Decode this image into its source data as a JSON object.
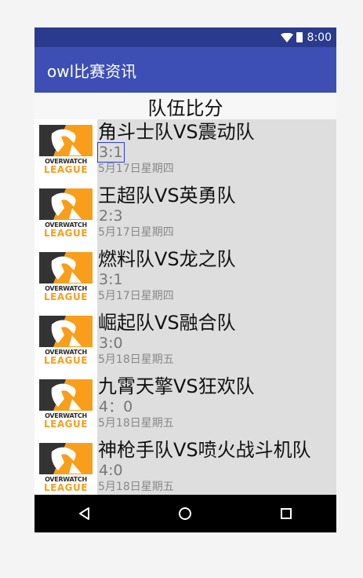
{
  "status_bar": {
    "time": "8:00",
    "wifi_icon": "wifi-icon",
    "battery_icon": "battery-icon"
  },
  "app_bar": {
    "title": "owl比赛资讯"
  },
  "section": {
    "title": "队伍比分"
  },
  "logo": {
    "top_text": "OVERWATCH",
    "bottom_text": "LEAGUE",
    "accent_color": "#f99e1a"
  },
  "matches": [
    {
      "teams": "角斗士队VS震动队",
      "score": "3:1",
      "date": "5月17日星期四"
    },
    {
      "teams": "王超队VS英勇队",
      "score": "2:3",
      "date": "5月17日星期四"
    },
    {
      "teams": "燃料队VS龙之队",
      "score": "3:1",
      "date": "5月17日星期四"
    },
    {
      "teams": "崛起队VS融合队",
      "score": "3:0",
      "date": "5月18日星期五"
    },
    {
      "teams": "九霄天擎VS狂欢队",
      "score": "4：0",
      "date": "5月18日星期五"
    },
    {
      "teams": "神枪手队VS喷火战斗机队",
      "score": "4:0",
      "date": "5月18日星期五"
    }
  ],
  "colors": {
    "status_bar": "#2a3a8e",
    "app_bar": "#3d4fb4",
    "row_bg": "#dedede"
  }
}
